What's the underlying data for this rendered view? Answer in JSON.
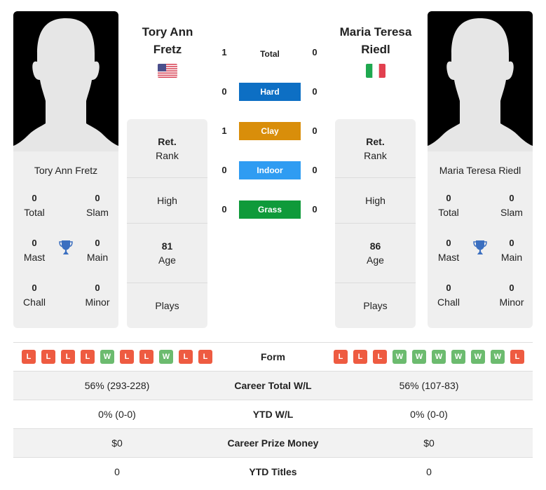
{
  "colors": {
    "hard": "#0d6fc4",
    "clay": "#d98e0a",
    "indoor": "#2f9cf2",
    "grass": "#0f9a3a",
    "win": "#6cbb6f",
    "loss": "#ee5b41",
    "trophy": "#3b6fc0"
  },
  "player1": {
    "name_line1": "Tory Ann",
    "name_line2": "Fretz",
    "full_name": "Tory Ann Fretz",
    "flag": "us-flag-icon",
    "titles": {
      "total": "0",
      "total_label": "Total",
      "slam": "0",
      "slam_label": "Slam",
      "mast": "0",
      "mast_label": "Mast",
      "main": "0",
      "main_label": "Main",
      "chall": "0",
      "chall_label": "Chall",
      "minor": "0",
      "minor_label": "Minor"
    },
    "stats": {
      "rank_value": "Ret.",
      "rank_label": "Rank",
      "high_label": "High",
      "age_value": "81",
      "age_label": "Age",
      "plays_label": "Plays"
    },
    "form": [
      "L",
      "L",
      "L",
      "L",
      "W",
      "L",
      "L",
      "W",
      "L",
      "L"
    ],
    "career_wl": "56% (293-228)",
    "ytd_wl": "0% (0-0)",
    "prize_money": "$0",
    "ytd_titles": "0"
  },
  "player2": {
    "name_line1": "Maria Teresa",
    "name_line2": "Riedl",
    "full_name": "Maria Teresa Riedl",
    "flag": "italy-flag-icon",
    "titles": {
      "total": "0",
      "total_label": "Total",
      "slam": "0",
      "slam_label": "Slam",
      "mast": "0",
      "mast_label": "Mast",
      "main": "0",
      "main_label": "Main",
      "chall": "0",
      "chall_label": "Chall",
      "minor": "0",
      "minor_label": "Minor"
    },
    "stats": {
      "rank_value": "Ret.",
      "rank_label": "Rank",
      "high_label": "High",
      "age_value": "86",
      "age_label": "Age",
      "plays_label": "Plays"
    },
    "form": [
      "L",
      "L",
      "L",
      "W",
      "W",
      "W",
      "W",
      "W",
      "W",
      "L"
    ],
    "career_wl": "56% (107-83)",
    "ytd_wl": "0% (0-0)",
    "prize_money": "$0",
    "ytd_titles": "0"
  },
  "h2h": [
    {
      "label": "Total",
      "p1": "1",
      "p2": "0"
    },
    {
      "label": "Hard",
      "p1": "0",
      "p2": "0"
    },
    {
      "label": "Clay",
      "p1": "1",
      "p2": "0"
    },
    {
      "label": "Indoor",
      "p1": "0",
      "p2": "0"
    },
    {
      "label": "Grass",
      "p1": "0",
      "p2": "0"
    }
  ],
  "comparison_labels": {
    "form": "Form",
    "career_wl": "Career Total W/L",
    "ytd_wl": "YTD W/L",
    "prize_money": "Career Prize Money",
    "ytd_titles": "YTD Titles"
  }
}
